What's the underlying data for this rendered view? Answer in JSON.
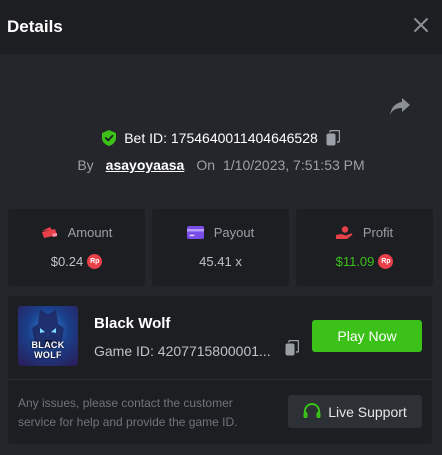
{
  "header": {
    "title": "Details"
  },
  "bet": {
    "id_text": "Bet ID: 1754640011404646528",
    "by_label": "By",
    "username": "asayoyaasa",
    "on_label": "On",
    "datetime": "1/10/2023, 7:51:53 PM"
  },
  "stats": [
    {
      "label": "Amount",
      "value": "$0.24",
      "currency_badge": "Rp",
      "icon": "wallet-icon"
    },
    {
      "label": "Payout",
      "value": "45.41 x",
      "icon": "card-icon"
    },
    {
      "label": "Profit",
      "value": "$11.09",
      "currency_badge": "Rp",
      "icon": "hand-coin-icon"
    }
  ],
  "game": {
    "thumb_text": "BLACK WOLF",
    "name": "Black Wolf",
    "id_text": "Game ID: 4207715800001...",
    "play_label": "Play Now",
    "notice": "Any issues, please contact the customer service for help and provide the game ID.",
    "support_label": "Live Support"
  },
  "colors": {
    "accent_green": "#3bc117",
    "profit_green": "#3bc117",
    "amount_pink": "#e8414a",
    "payout_purple": "#7b4de8",
    "profit_red": "#e8414a"
  }
}
